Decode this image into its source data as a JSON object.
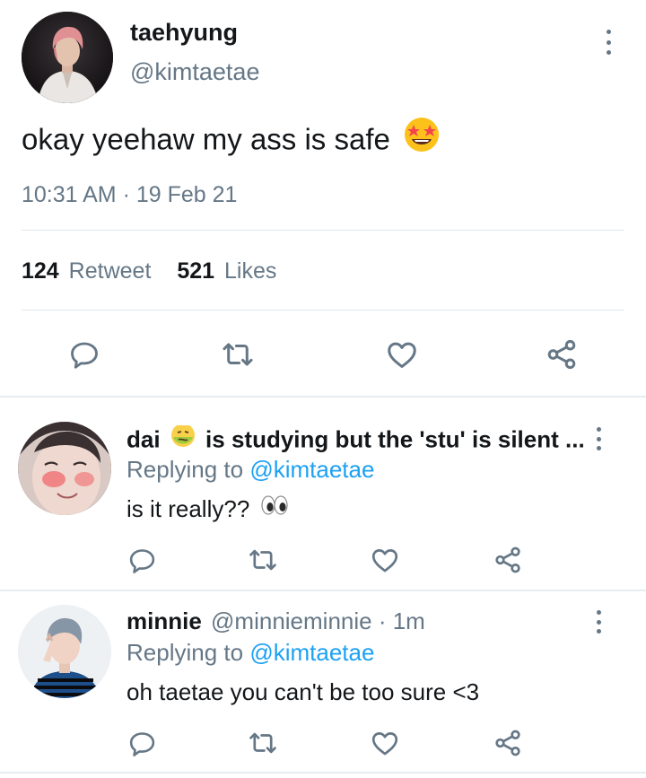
{
  "main_tweet": {
    "display_name": "taehyung",
    "handle": "@kimtaetae",
    "text": "okay yeehaw my ass is safe",
    "emoji": "star-struck-emoji",
    "timestamp": "10:31 AM · 19 Feb 21",
    "stats": {
      "retweet_count": "124",
      "retweet_label": "Retweet",
      "likes_count": "521",
      "likes_label": "Likes"
    }
  },
  "replies": [
    {
      "display_name": "dai",
      "name_emoji": "nauseated-face-emoji",
      "name_suffix": "is studying but the 'stu' is silent ...",
      "replying_prefix": "Replying to",
      "replying_handle": "@kimtaetae",
      "text": "is it really??",
      "text_emoji": "eyes-emoji"
    },
    {
      "display_name": "minnie",
      "handle_meta": "@minnieminnie · 1m",
      "replying_prefix": "Replying to",
      "replying_handle": "@kimtaetae",
      "text": "oh taetae you can't be too sure <3"
    }
  ],
  "colors": {
    "text": "#14171a",
    "muted": "#657786",
    "link": "#1da1f2",
    "divider": "#e1e8ed"
  }
}
